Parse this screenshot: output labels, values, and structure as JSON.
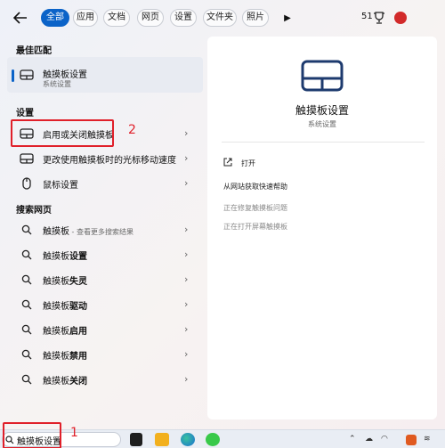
{
  "filters": [
    "全部",
    "应用",
    "文档",
    "网页",
    "设置",
    "文件夹",
    "照片"
  ],
  "active_filter": "全部",
  "header": {
    "count": "51"
  },
  "best_match": {
    "heading": "最佳匹配",
    "title": "触摸板设置",
    "subtitle": "系统设置"
  },
  "settings": {
    "heading": "设置",
    "items": [
      {
        "label": "启用或关闭触摸板"
      },
      {
        "label": "更改使用触摸板时的光标移动速度"
      },
      {
        "label": "鼠标设置"
      }
    ]
  },
  "web": {
    "heading": "搜索网页",
    "items": [
      {
        "prefix": "触摸板",
        "bold": "",
        "suffix": " - 查看更多搜索结果"
      },
      {
        "prefix": "触摸板",
        "bold": "设置",
        "suffix": ""
      },
      {
        "prefix": "触摸板",
        "bold": "失灵",
        "suffix": ""
      },
      {
        "prefix": "触摸板",
        "bold": "驱动",
        "suffix": ""
      },
      {
        "prefix": "触摸板",
        "bold": "启用",
        "suffix": ""
      },
      {
        "prefix": "触摸板",
        "bold": "禁用",
        "suffix": ""
      },
      {
        "prefix": "触摸板",
        "bold": "关闭",
        "suffix": ""
      }
    ]
  },
  "detail": {
    "title": "触摸板设置",
    "subtitle": "系统设置",
    "actions": [
      {
        "label": "打开"
      },
      {
        "label": "从网站获取快速帮助"
      },
      {
        "label": "正在修复触摸板问题"
      },
      {
        "label": "正在打开屏幕触摸板"
      }
    ]
  },
  "annotations": {
    "label1": "1",
    "label2": "2"
  },
  "taskbar": {
    "search_value": "触摸板设置"
  },
  "colors": {
    "accent": "#0b63c8",
    "annotation": "#e0202a"
  }
}
